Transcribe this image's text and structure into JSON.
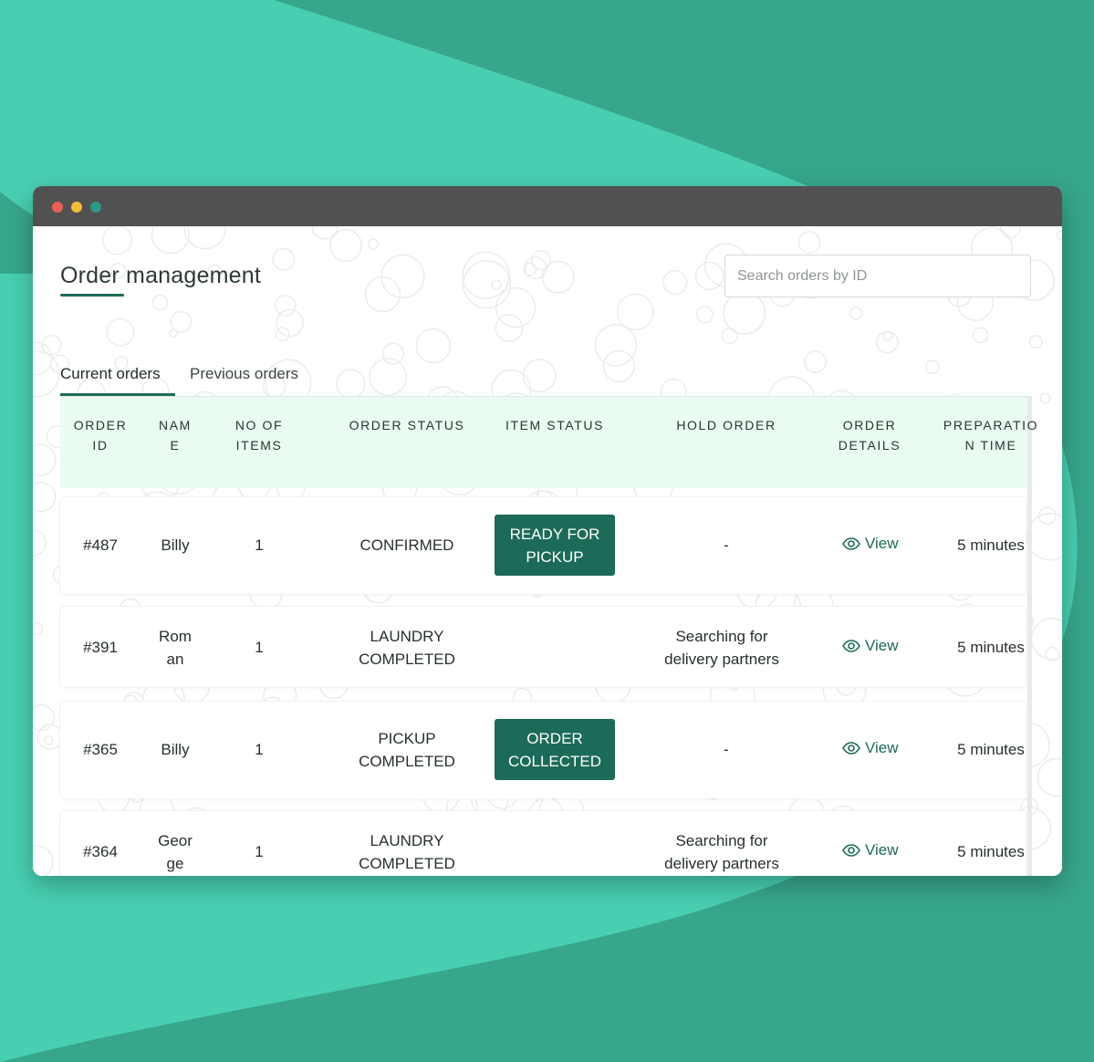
{
  "colors": {
    "background_dark": "#37a68b",
    "background_light": "#48cfb2",
    "accent": "#1c6a58",
    "header_bg": "#eafbf2",
    "titlebar": "#515151"
  },
  "window": {
    "traffic_lights": [
      "close-dot",
      "minimize-dot",
      "maximize-dot"
    ]
  },
  "page": {
    "title": "Order management",
    "search_placeholder": "Search orders by ID"
  },
  "tabs": [
    {
      "label": "Current orders",
      "active": true
    },
    {
      "label": "Previous orders",
      "active": false
    }
  ],
  "table": {
    "headers": [
      [
        "ORDER",
        "ID"
      ],
      [
        "NAM",
        "E"
      ],
      [
        "NO OF",
        "ITEMS"
      ],
      [
        "ORDER STATUS"
      ],
      [
        "ITEM STATUS"
      ],
      [
        "HOLD ORDER"
      ],
      [
        "ORDER",
        "DETAILS"
      ],
      [
        "PREPARATIO",
        "N TIME"
      ]
    ],
    "rows": [
      {
        "order_id": "#487",
        "name": [
          "Billy"
        ],
        "items": "1",
        "order_status": [
          "CONFIRMED"
        ],
        "item_status": [
          "READY FOR",
          "PICKUP"
        ],
        "hold_order": [
          "-"
        ],
        "details": "View",
        "prep_time": "5 minutes"
      },
      {
        "order_id": "#391",
        "name": [
          "Rom",
          "an"
        ],
        "items": "1",
        "order_status": [
          "LAUNDRY",
          "COMPLETED"
        ],
        "item_status": [],
        "hold_order": [
          "Searching for",
          "delivery partners"
        ],
        "details": "View",
        "prep_time": "5 minutes"
      },
      {
        "order_id": "#365",
        "name": [
          "Billy"
        ],
        "items": "1",
        "order_status": [
          "PICKUP",
          "COMPLETED"
        ],
        "item_status": [
          "ORDER",
          "COLLECTED"
        ],
        "hold_order": [
          "-"
        ],
        "details": "View",
        "prep_time": "5 minutes"
      },
      {
        "order_id": "#364",
        "name": [
          "Geor",
          "ge"
        ],
        "items": "1",
        "order_status": [
          "LAUNDRY",
          "COMPLETED"
        ],
        "item_status": [],
        "hold_order": [
          "Searching for",
          "delivery partners"
        ],
        "details": "View",
        "prep_time": "5 minutes"
      }
    ]
  }
}
